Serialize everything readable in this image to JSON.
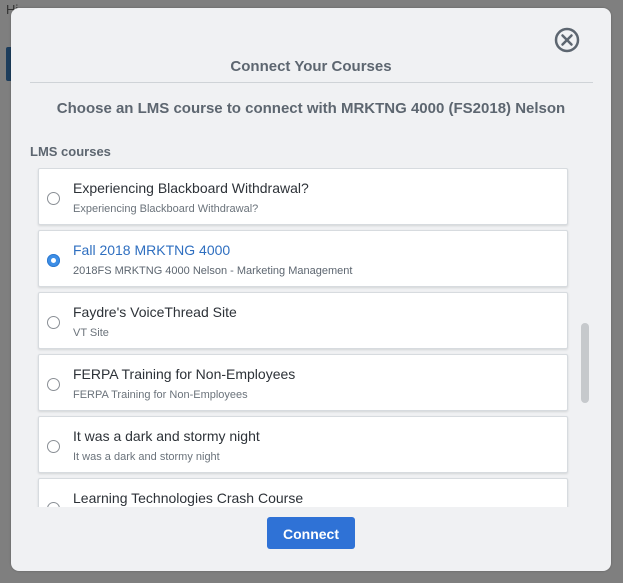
{
  "background": {
    "fragment_text": "Hi",
    "accent": "#1d3d5c"
  },
  "modal": {
    "title": "Connect Your Courses",
    "subtitle": "Choose an LMS course to connect with MRKTNG 4000 (FS2018) Nelson",
    "section_label": "LMS courses",
    "close_icon": "circle-x-icon",
    "courses": [
      {
        "title": "Experiencing Blackboard Withdrawal?",
        "subtitle": "Experiencing Blackboard Withdrawal?",
        "selected": false
      },
      {
        "title": "Fall 2018 MRKTNG 4000",
        "subtitle": "2018FS MRKTNG 4000 Nelson - Marketing Management",
        "selected": true
      },
      {
        "title": "Faydre's VoiceThread Site",
        "subtitle": "VT Site",
        "selected": false
      },
      {
        "title": "FERPA Training for Non-Employees",
        "subtitle": "FERPA Training for Non-Employees",
        "selected": false
      },
      {
        "title": "It was a dark and stormy night",
        "subtitle": "It was a dark and stormy night",
        "selected": false
      },
      {
        "title": "Learning Technologies Crash Course",
        "subtitle": "",
        "selected": false
      }
    ],
    "connect_label": "Connect",
    "colors": {
      "primary": "#2f72d6",
      "selected_text": "#2f6fc0",
      "radio_checked": "#3d8ee6"
    }
  }
}
